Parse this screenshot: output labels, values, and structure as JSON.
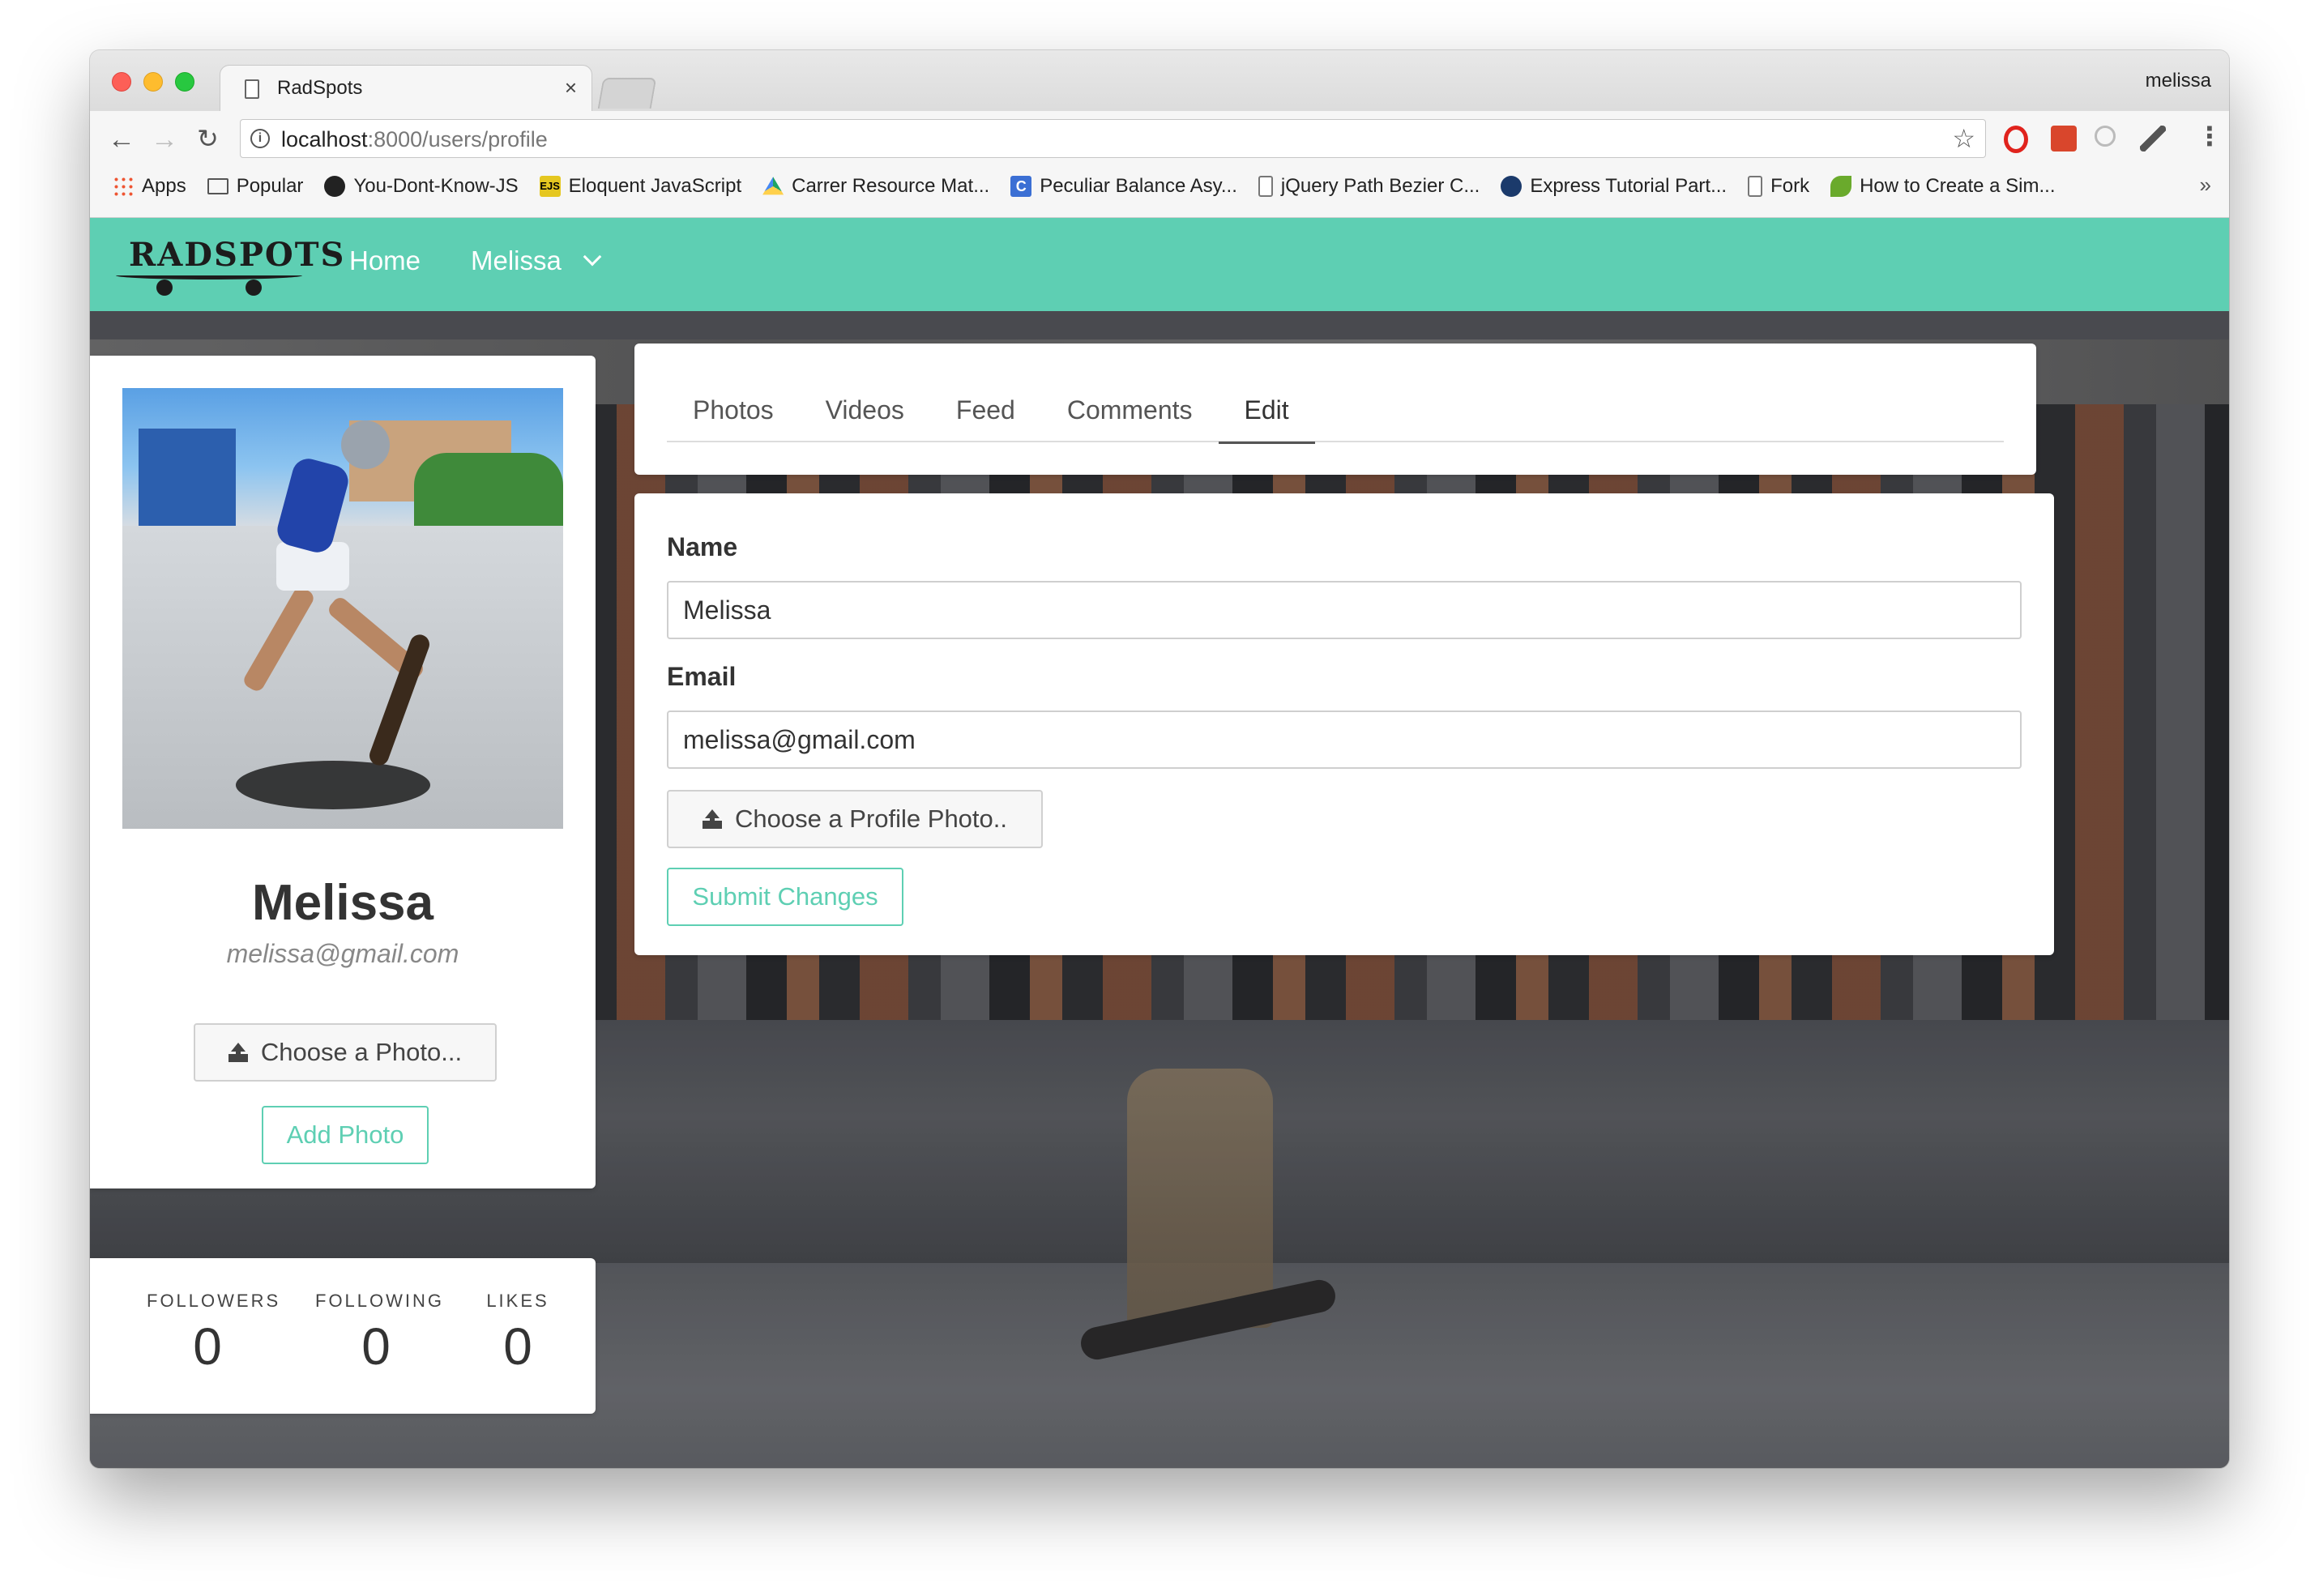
{
  "browser": {
    "tab_title": "RadSpots",
    "tab_close": "×",
    "profile_name": "melissa",
    "url_host": "localhost",
    "url_rest": ":8000/users/profile",
    "nav": {
      "back": "←",
      "forward": "→",
      "reload": "↻"
    },
    "star": "☆",
    "menu": "⋮",
    "bookmarks": [
      {
        "label": "Apps",
        "icon": "apps-grid-icon"
      },
      {
        "label": "Popular",
        "icon": "folder-icon"
      },
      {
        "label": "You-Dont-Know-JS",
        "icon": "github-icon"
      },
      {
        "label": "Eloquent JavaScript",
        "icon": "ejs-icon"
      },
      {
        "label": "Carrer Resource Mat...",
        "icon": "google-drive-icon"
      },
      {
        "label": "Peculiar Balance Asy...",
        "icon": "c-icon"
      },
      {
        "label": "jQuery Path Bezier C...",
        "icon": "page-icon"
      },
      {
        "label": "Express Tutorial Part...",
        "icon": "mdn-icon"
      },
      {
        "label": "Fork",
        "icon": "page-icon"
      },
      {
        "label": "How to Create a Sim...",
        "icon": "leaf-icon"
      }
    ],
    "bookmarks_more": "»"
  },
  "app": {
    "logo_text": "RADSPOTS",
    "nav": {
      "home": "Home",
      "user": "Melissa"
    },
    "accent_color": "#5ecfb3"
  },
  "profile": {
    "name": "Melissa",
    "email": "melissa@gmail.com",
    "choose_photo_label": "Choose a Photo...",
    "add_photo_label": "Add Photo",
    "stats": {
      "followers_label": "FOLLOWERS",
      "followers": "0",
      "following_label": "FOLLOWING",
      "following": "0",
      "likes_label": "LIKES",
      "likes": "0"
    }
  },
  "tabs": [
    {
      "label": "Photos",
      "active": false
    },
    {
      "label": "Videos",
      "active": false
    },
    {
      "label": "Feed",
      "active": false
    },
    {
      "label": "Comments",
      "active": false
    },
    {
      "label": "Edit",
      "active": true
    }
  ],
  "edit_form": {
    "name_label": "Name",
    "name_value": "Melissa",
    "email_label": "Email",
    "email_value": "melissa@gmail.com",
    "choose_profile_photo_label": "Choose a Profile Photo..",
    "submit_label": "Submit Changes"
  }
}
